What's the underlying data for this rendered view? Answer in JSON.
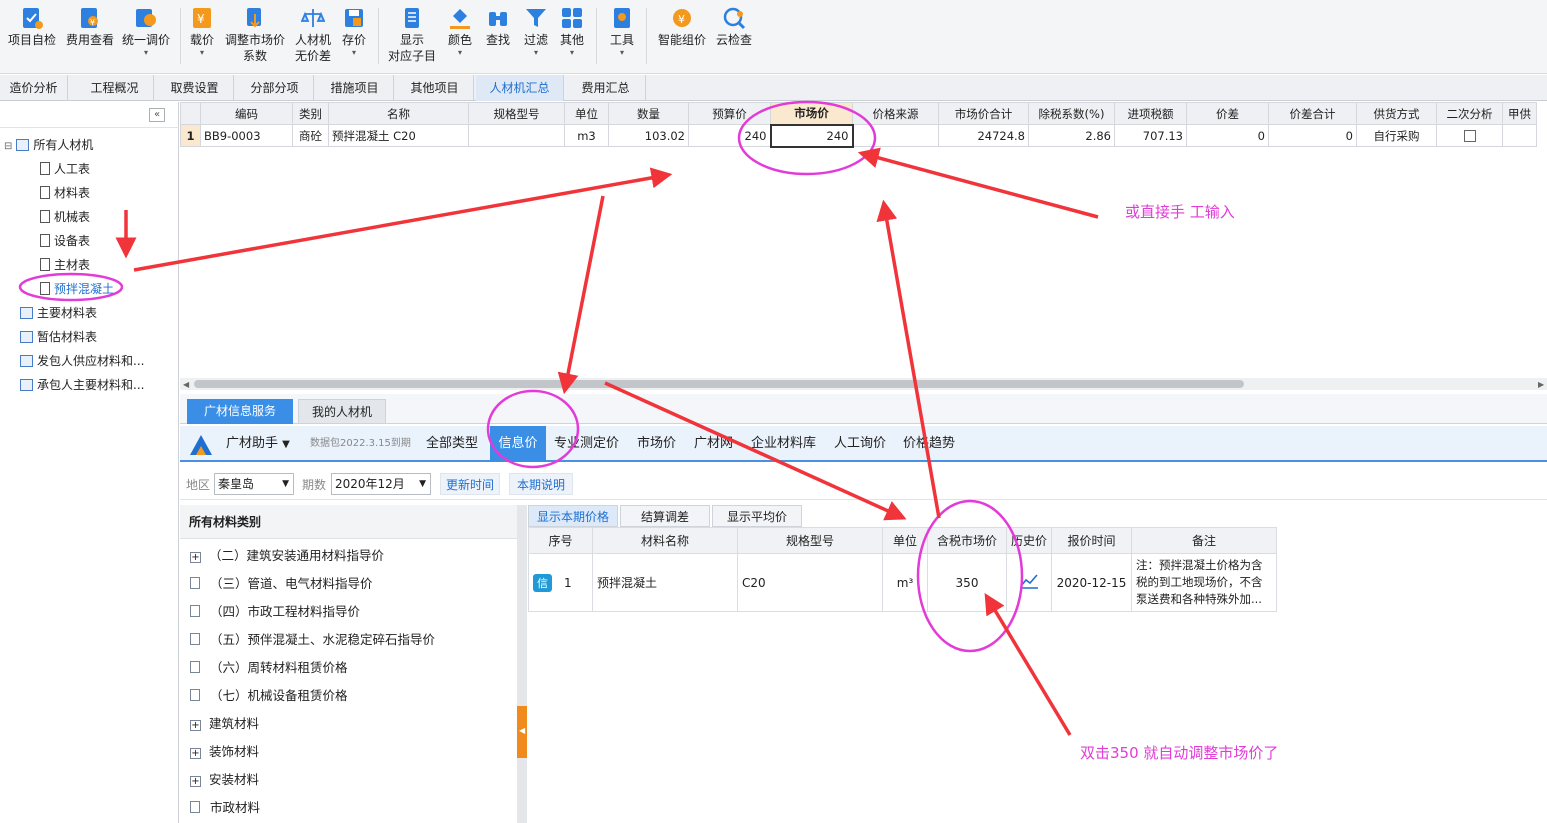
{
  "toolbar": {
    "items": [
      {
        "label": "项目自检",
        "icon": "check-icon"
      },
      {
        "label": "费用查看",
        "icon": "cost-view-icon"
      },
      {
        "label": "统一调价",
        "icon": "adjust-price-icon"
      },
      {
        "label": "载价",
        "icon": "load-price-icon"
      },
      {
        "label": "调整市场价\n系数",
        "icon": "market-coef-icon"
      },
      {
        "label": "人材机\n无价差",
        "icon": "balance-icon"
      },
      {
        "label": "存价",
        "icon": "save-price-icon"
      },
      {
        "label": "显示\n对应子目",
        "icon": "list-icon"
      },
      {
        "label": "颜色",
        "icon": "paint-bucket-icon"
      },
      {
        "label": "查找",
        "icon": "binoculars-icon"
      },
      {
        "label": "过滤",
        "icon": "filter-icon"
      },
      {
        "label": "其他",
        "icon": "grid-icon"
      },
      {
        "label": "工具",
        "icon": "tool-icon"
      },
      {
        "label": "智能组价",
        "icon": "smart-price-icon"
      },
      {
        "label": "云检查",
        "icon": "cloud-check-icon"
      }
    ]
  },
  "tabs": [
    "造价分析",
    "工程概况",
    "取费设置",
    "分部分项",
    "措施项目",
    "其他项目",
    "人材机汇总",
    "费用汇总"
  ],
  "tree": {
    "collapse_glyph": "«",
    "root": "所有人材机",
    "children": [
      "人工表",
      "材料表",
      "机械表",
      "设备表",
      "主材表",
      "预拌混凝土"
    ],
    "others": [
      "主要材料表",
      "暂估材料表",
      "发包人供应材料和...",
      "承包人主要材料和..."
    ]
  },
  "grid": {
    "headers": [
      "编码",
      "类别",
      "名称",
      "规格型号",
      "单位",
      "数量",
      "预算价",
      "市场价",
      "价格来源",
      "市场价合计",
      "除税系数(%)",
      "进项税额",
      "价差",
      "价差合计",
      "供货方式",
      "二次分析",
      "甲供"
    ],
    "row": {
      "no": "1",
      "code": "BB9-0003",
      "type": "商砼",
      "name": "预拌混凝土 C20",
      "spec": "",
      "unit": "m3",
      "qty": "103.02",
      "budget": "240",
      "market": "240",
      "source": "",
      "total": "24724.8",
      "coef": "2.86",
      "tax": "707.13",
      "diff": "0",
      "diffsum": "0",
      "supply": "自行采购"
    }
  },
  "bottom": {
    "tabs": [
      "广材信息服务",
      "我的人材机"
    ],
    "assistant": "广材助手",
    "data_pkg": "数据包2022.3.15到期",
    "nav": [
      "全部类型",
      "信息价",
      "专业测定价",
      "市场价",
      "广材网",
      "企业材料库",
      "人工询价",
      "价格趋势"
    ],
    "filter": {
      "region_label": "地区",
      "region": "秦皇岛",
      "period_label": "期数",
      "period": "2020年12月",
      "update_btn": "更新时间",
      "note_btn": "本期说明"
    },
    "category_title": "所有材料类别",
    "categories": [
      "（二）建筑安装通用材料指导价",
      "（三）管道、电气材料指导价",
      "（四）市政工程材料指导价",
      "（五）预伴混凝土、水泥稳定碎石指导价",
      "（六）周转材料租赁价格",
      "（七）机械设备租赁价格",
      "建筑材料",
      "装饰材料",
      "安装材料",
      "市政材料"
    ],
    "subtabs": [
      "显示本期价格",
      "结算调差",
      "显示平均价"
    ],
    "info_headers": [
      "序号",
      "材料名称",
      "规格型号",
      "单位",
      "含税市场价",
      "历史价",
      "报价时间",
      "备注"
    ],
    "info_row": {
      "badge": "信",
      "no": "1",
      "name": "预拌混凝土",
      "spec": "C20",
      "unit": "m³",
      "price": "350",
      "date": "2020-12-15",
      "note": "注：预拌混凝土价格为含税的到工地现场价，不含泵送费和各种特殊外加..."
    }
  },
  "annotations": {
    "a1": "或直接手 工输入",
    "a2": "双击350  就自动调整市场价了"
  },
  "colors": {
    "accent": "#1f6fd1",
    "annotation": "#e23bd8",
    "arrow": "#f0343a"
  }
}
